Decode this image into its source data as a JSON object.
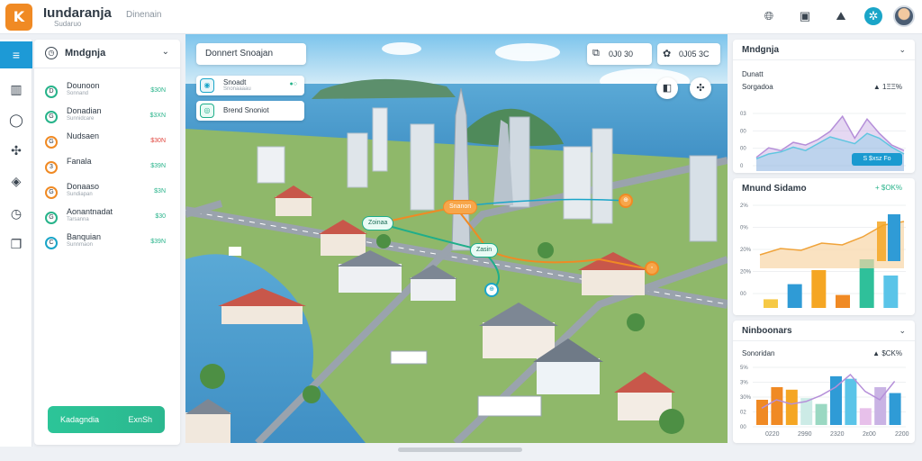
{
  "header": {
    "logo_text": "K",
    "title": "Iundaranja",
    "subtitle": "Sudaruo",
    "center_text": "Dinenain",
    "icons": [
      "globe-icon",
      "layout-icon",
      "route-icon",
      "settings-icon"
    ],
    "brand_color": "#f08a24",
    "accent_color": "#1aa5c8"
  },
  "rail": {
    "items": [
      {
        "icon": "menu-icon",
        "glyph": "≡",
        "active": true
      },
      {
        "icon": "chart-icon",
        "glyph": "▥",
        "active": false
      },
      {
        "icon": "search-icon",
        "glyph": "◯",
        "active": false
      },
      {
        "icon": "network-icon",
        "glyph": "✣",
        "active": false
      },
      {
        "icon": "bag-icon",
        "glyph": "◈",
        "active": false
      },
      {
        "icon": "clock-icon",
        "glyph": "◷",
        "active": false
      },
      {
        "icon": "pages-icon",
        "glyph": "❐",
        "active": false
      }
    ]
  },
  "list": {
    "title": "Mndgnja",
    "items": [
      {
        "label": "Dounoon",
        "sub": "Sonnand",
        "value": "$30N",
        "color": "#27b38a",
        "value_color": "#27b38a",
        "marker": "D"
      },
      {
        "label": "Donadian",
        "sub": "Sunnidcare",
        "value": "$3XN",
        "color": "#27b38a",
        "value_color": "#27b38a",
        "marker": "G"
      },
      {
        "label": "Nudsaen",
        "sub": "",
        "value": "$30N",
        "color": "#f08a24",
        "value_color": "#e0443c",
        "marker": "G"
      },
      {
        "label": "Fanala",
        "sub": "",
        "value": "$39N",
        "color": "#f08a24",
        "value_color": "#27b38a",
        "marker": "3"
      },
      {
        "label": "Donaaso",
        "sub": "Sundiapan",
        "value": "$3N",
        "color": "#f08a24",
        "value_color": "#27b38a",
        "marker": "G"
      },
      {
        "label": "Aonantnadat",
        "sub": "Tarsanna",
        "value": "$30",
        "color": "#27b38a",
        "value_color": "#27b38a",
        "marker": "G"
      },
      {
        "label": "Banquian",
        "sub": "Sunnmaon",
        "value": "$39N",
        "color": "#1aa5c8",
        "value_color": "#27b38a",
        "marker": "C"
      }
    ],
    "cta_left": "Kadagndia",
    "cta_right": "ExnSh"
  },
  "map": {
    "search_text": "Donnert Snoajan",
    "layers": [
      {
        "label": "Snoadt",
        "sub": "Snonaaaau",
        "toggle": "●○"
      },
      {
        "label": "Brend Snoniot",
        "sub": "",
        "toggle": ""
      }
    ],
    "stat1": "0J0 30",
    "stat2": "0J05 3C",
    "stat1_icon": "layers-icon",
    "stat2_icon": "bug-icon",
    "pins": [
      "Zoinaa",
      "Snanon",
      "Zasin"
    ]
  },
  "cards": {
    "card1": {
      "title": "Mndgnja",
      "metric_a": "Dunatt",
      "metric_b": "Sorgadoa",
      "delta": "▲ 1ΞΞ%",
      "button": "S $xsz Fo"
    },
    "card2": {
      "title": "Mnund Sidamo",
      "delta": "+ $OK%"
    },
    "card3": {
      "title": "Ninboonars",
      "metric_a": "Sonoridan",
      "delta": "▲ $CK%",
      "x_labels": [
        "0220",
        "2990",
        "2320",
        "2ε00",
        "2200"
      ]
    }
  },
  "chart_data": [
    {
      "type": "area",
      "title": "Mndgnja",
      "ylabel": "",
      "y_ticks": [
        "03",
        "00",
        "00",
        "0"
      ],
      "series": [
        {
          "values": [
            20,
            34,
            30,
            42,
            38,
            46,
            58,
            80,
            48,
            76,
            55,
            38,
            30
          ],
          "color": "#b58fd9"
        },
        {
          "values": [
            18,
            25,
            28,
            35,
            30,
            40,
            50,
            45,
            40,
            55,
            48,
            35,
            25
          ],
          "color": "#5fc6e0"
        }
      ],
      "ylim": [
        0,
        100
      ]
    },
    {
      "type": "bar",
      "title": "Mnund Sidamo",
      "y_ticks": [
        "2%",
        "0%",
        "20%",
        "20%",
        "00"
      ],
      "values": [
        8,
        22,
        35,
        12,
        45,
        30
      ],
      "colors": [
        "#f6c945",
        "#2f9bd6",
        "#f5a623",
        "#f08a24",
        "#2fc09a",
        "#5ac4e8"
      ],
      "line": [
        55,
        62,
        60,
        68,
        66,
        75,
        88,
        92
      ],
      "ylim": [
        0,
        100
      ]
    },
    {
      "type": "bar",
      "title": "Ninboonars",
      "categories": [
        "0220",
        "2990",
        "2320",
        "2ε00",
        "2200"
      ],
      "y_ticks": [
        "5%",
        "3%",
        "30%",
        "02",
        "00"
      ],
      "values": [
        30,
        45,
        42,
        32,
        25,
        58,
        55,
        20,
        45,
        38
      ],
      "colors": [
        "#f08a24",
        "#f08a24",
        "#f5a623",
        "#ccebe6",
        "#9ad8c2",
        "#2f9bd6",
        "#5ac4e8",
        "#e7c0ea",
        "#c9b3e4",
        "#2f9bd6"
      ],
      "line": [
        20,
        30,
        25,
        28,
        35,
        45,
        60,
        40,
        30,
        52
      ],
      "ylim": [
        0,
        100
      ]
    }
  ]
}
